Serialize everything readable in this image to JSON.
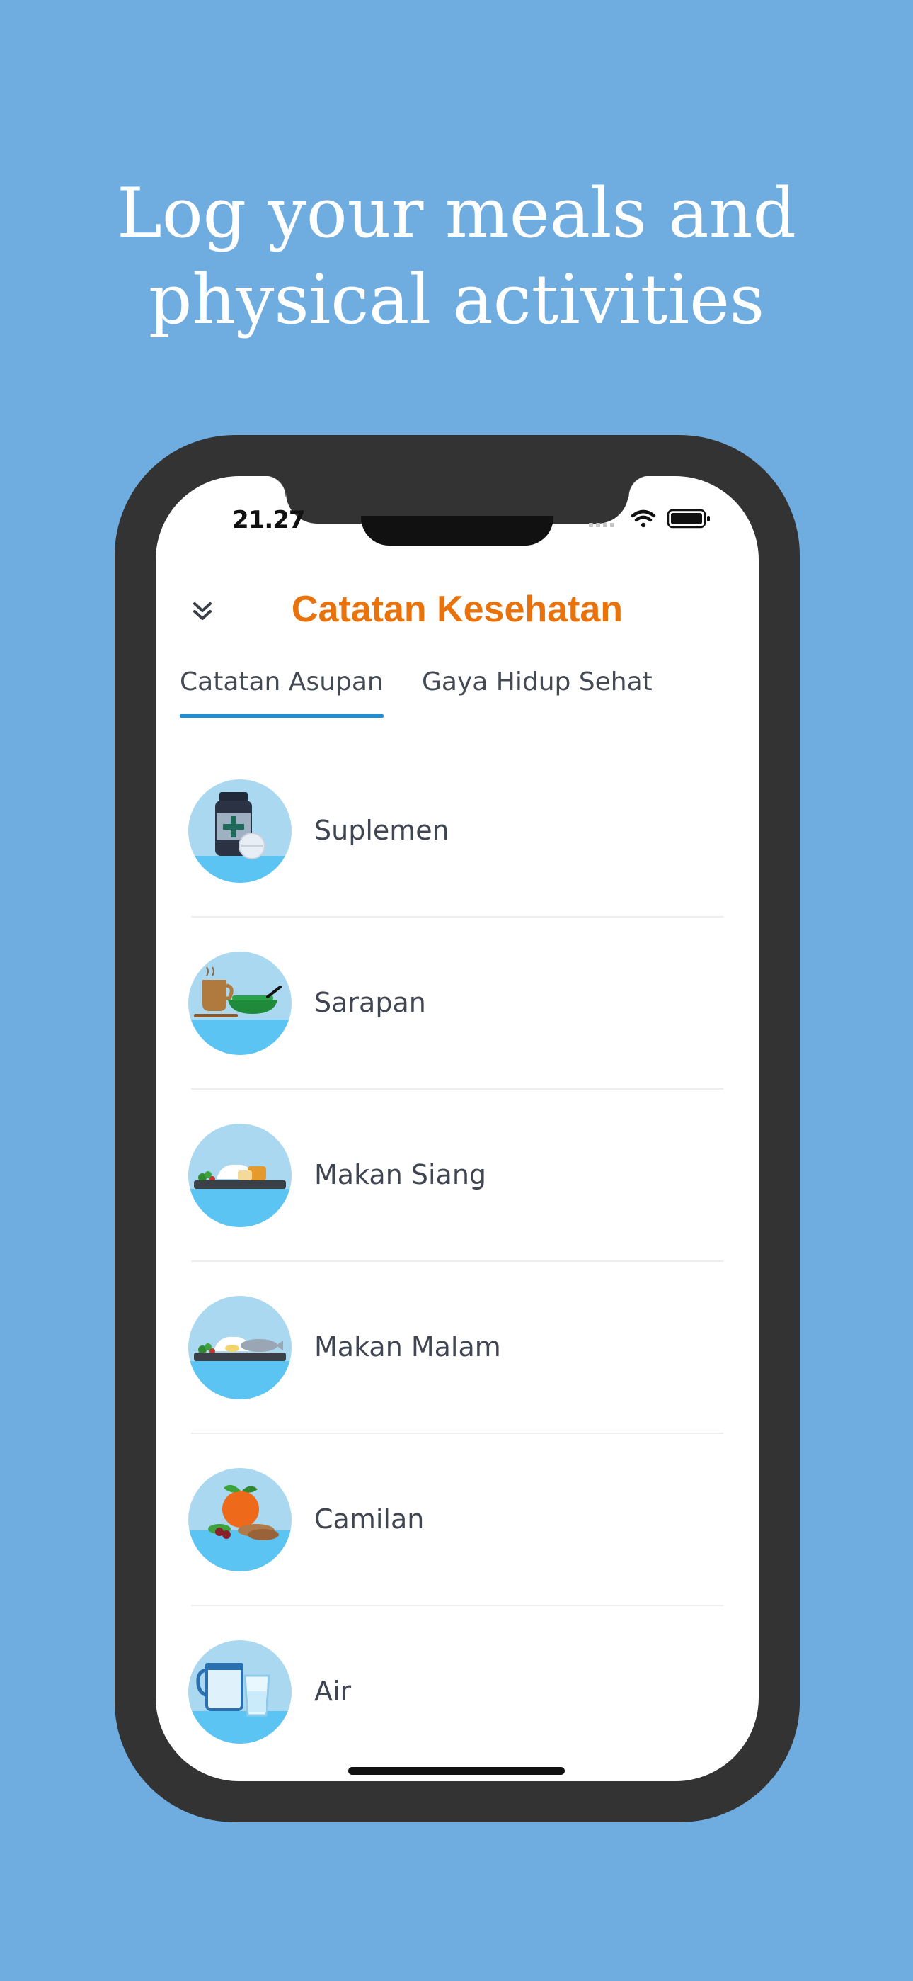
{
  "headline": {
    "line1": "Log your meals and",
    "line2": "physical activities"
  },
  "status_bar": {
    "time": "21.27",
    "icons": [
      "signal-icon",
      "wifi-icon",
      "battery-icon"
    ]
  },
  "header": {
    "title": "Catatan Kesehatan",
    "collapse_icon": "double-chevron-down-icon"
  },
  "tabs": [
    {
      "label": "Catatan Asupan",
      "active": true
    },
    {
      "label": "Gaya Hidup Sehat",
      "active": false
    }
  ],
  "items": [
    {
      "label": "Suplemen",
      "icon": "supplement-icon"
    },
    {
      "label": "Sarapan",
      "icon": "breakfast-icon"
    },
    {
      "label": "Makan Siang",
      "icon": "lunch-icon"
    },
    {
      "label": "Makan Malam",
      "icon": "dinner-icon"
    },
    {
      "label": "Camilan",
      "icon": "snack-icon"
    },
    {
      "label": "Air",
      "icon": "water-icon"
    }
  ],
  "colors": {
    "background": "#6FACE0",
    "title": "#E8720C",
    "tab_indicator": "#1E90D6",
    "phone_frame": "#333333",
    "icon_bg_light": "#A9D8F0",
    "icon_bg_dark": "#5BC4F2"
  }
}
